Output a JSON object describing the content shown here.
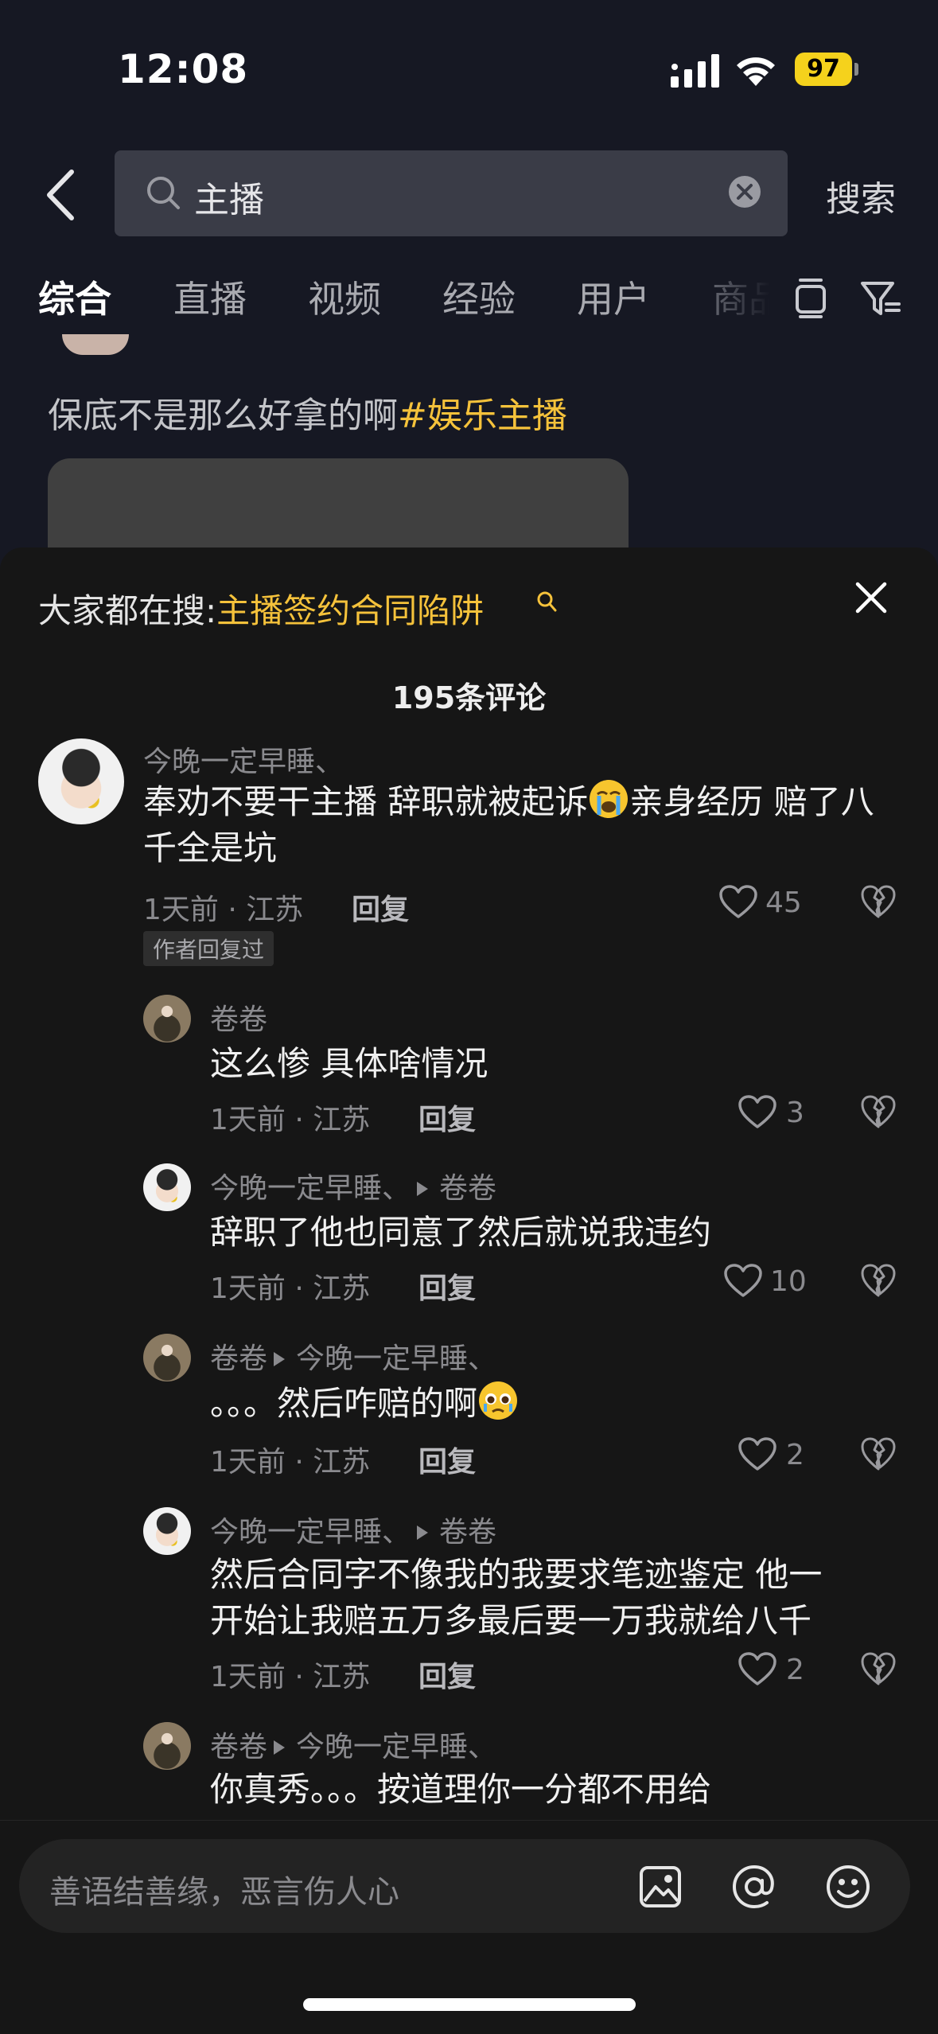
{
  "status_bar": {
    "time": "12:08",
    "battery": "97"
  },
  "search": {
    "query": "主播",
    "button_label": "搜索"
  },
  "tabs": [
    {
      "label": "综合"
    },
    {
      "label": "直播"
    },
    {
      "label": "视频"
    },
    {
      "label": "经验"
    },
    {
      "label": "用户"
    },
    {
      "label": "商品"
    }
  ],
  "post": {
    "text": "保底不是那么好拿的啊",
    "tag": "#娱乐主播"
  },
  "sheet": {
    "hot_search_label": "大家都在搜:",
    "hot_search_keyword": "主播签约合同陷阱",
    "comment_count": "195条评论"
  },
  "comments": [
    {
      "username": "今晚一定早睡、",
      "text_before_emoji": "奉劝不要干主播 辞职就被起诉",
      "emoji": "loudly-crying-face",
      "text_after_emoji": "亲身经历 赔了八千全是坑",
      "meta": "1天前 · 江苏",
      "reply_label": "回复",
      "likes": "45",
      "badge": "作者回复过"
    }
  ],
  "replies": [
    {
      "username": "卷卷",
      "reply_to": "",
      "text": "这么惨 具体啥情况",
      "meta": "1天前 · 江苏",
      "reply_label": "回复",
      "likes": "3"
    },
    {
      "username": "今晚一定早睡、",
      "reply_to": "卷卷",
      "text": "辞职了他也同意了然后就说我违约",
      "meta": "1天前 · 江苏",
      "reply_label": "回复",
      "likes": "10"
    },
    {
      "username": "卷卷",
      "reply_to": "今晚一定早睡、",
      "text": "。。。然后咋赔的啊",
      "emoji": "pleading-face",
      "meta": "1天前 · 江苏",
      "reply_label": "回复",
      "likes": "2"
    },
    {
      "username": "今晚一定早睡、",
      "reply_to": "卷卷",
      "text_line1": "然后合同字不像我的我要求笔迹鉴定 他一",
      "text_line2": "开始让我赔五万多最后要一万我就给八千",
      "meta": "1天前 · 江苏",
      "reply_label": "回复",
      "likes": "2"
    },
    {
      "username": "卷卷",
      "reply_to": "今晚一定早睡、",
      "text": "你真秀。。。按道理你一分都不用给"
    }
  ],
  "input": {
    "placeholder": "善语结善缘，恶言伤人心"
  },
  "icons": {
    "back": "chevron-left-icon",
    "search": "search-icon",
    "clear": "clear-icon",
    "close": "close-icon",
    "like": "heart-icon",
    "dislike": "broken-heart-icon",
    "image": "image-icon",
    "mention": "at-icon",
    "emoji": "emoji-icon"
  },
  "colors": {
    "accent": "#f5c23b",
    "background": "#161823",
    "sheet": "#161616",
    "battery": "#f5d21c"
  }
}
